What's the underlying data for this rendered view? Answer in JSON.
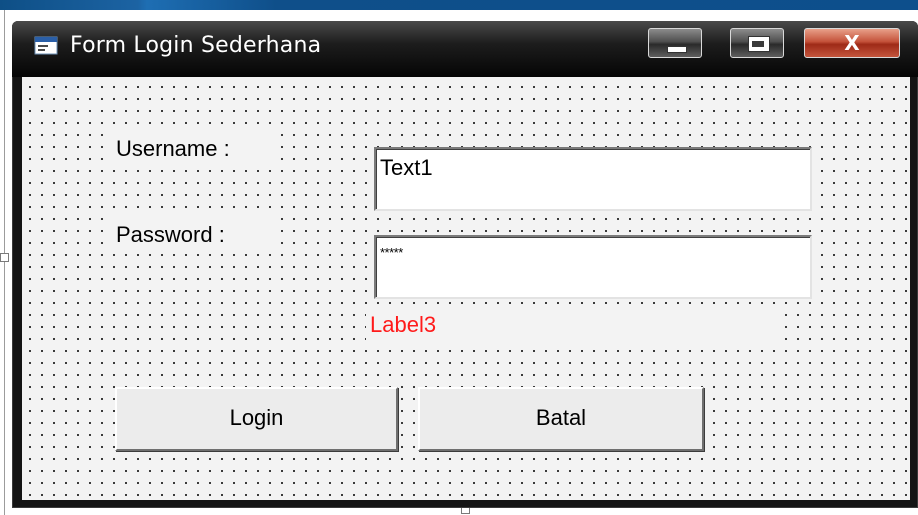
{
  "window": {
    "title": "Form Login Sederhana",
    "controls": {
      "minimize": "minimize",
      "maximize": "maximize",
      "close": "X"
    }
  },
  "form": {
    "username_label": "Username :",
    "username_value": "Text1",
    "password_label": "Password :",
    "password_value": "*****",
    "message_label": "Label3",
    "message_color": "#ff1a1a",
    "login_button": "Login",
    "cancel_button": "Batal"
  },
  "icons": {
    "app": "form-window-icon",
    "minimize": "minimize-icon",
    "maximize": "maximize-icon",
    "close": "close-icon"
  }
}
